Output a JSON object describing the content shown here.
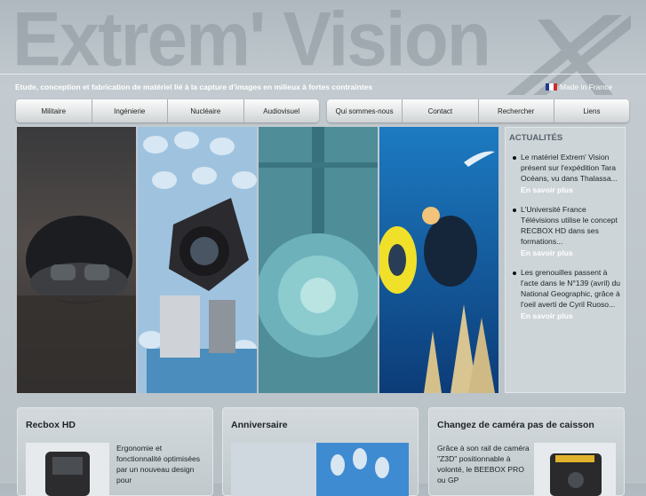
{
  "header": {
    "title": "Extrem' Vision",
    "tagline": "Etude, conception et fabrication de matériel lié à la capture d'images en milieux à fortes contraintes",
    "made_in": "Made in France",
    "flag_colors": [
      "#1f3a93",
      "#ffffff",
      "#d22a2a"
    ]
  },
  "nav": {
    "left": [
      "Militaire",
      "Ingénierie",
      "Nucléaire",
      "Audiovisuel"
    ],
    "right": [
      "Qui sommes-nous",
      "Contact",
      "Rechercher",
      "Liens"
    ]
  },
  "news": {
    "heading": "ACTUALITÉS",
    "more_label": "En savoir plus",
    "items": [
      {
        "text": "Le matériel Extrem' Vision présent sur l'expédition Tara Océans, vu dans Thalassa..."
      },
      {
        "text": "L'Université France Télévisions utilise le concept RECBOX HD dans ses formations..."
      },
      {
        "text": "Les grenouilles passent à l'acte dans le N°139 (avril) du National Geographic, grâce à l'oeil averti de Cyril Ruoso..."
      }
    ]
  },
  "cards": [
    {
      "title": "Recbox HD",
      "text": "Ergonomie et fonctionnalité optimisées par un nouveau design pour"
    },
    {
      "title": "Anniversaire",
      "text": ""
    },
    {
      "title": "Changez de caméra pas de caisson",
      "text": "Grâce à son rail de caméra \"Z3D\" positionnable à volonté, le BEEBOX PRO ou GP"
    }
  ],
  "colors": {
    "link": "#ffffff",
    "heading": "#55626a"
  }
}
